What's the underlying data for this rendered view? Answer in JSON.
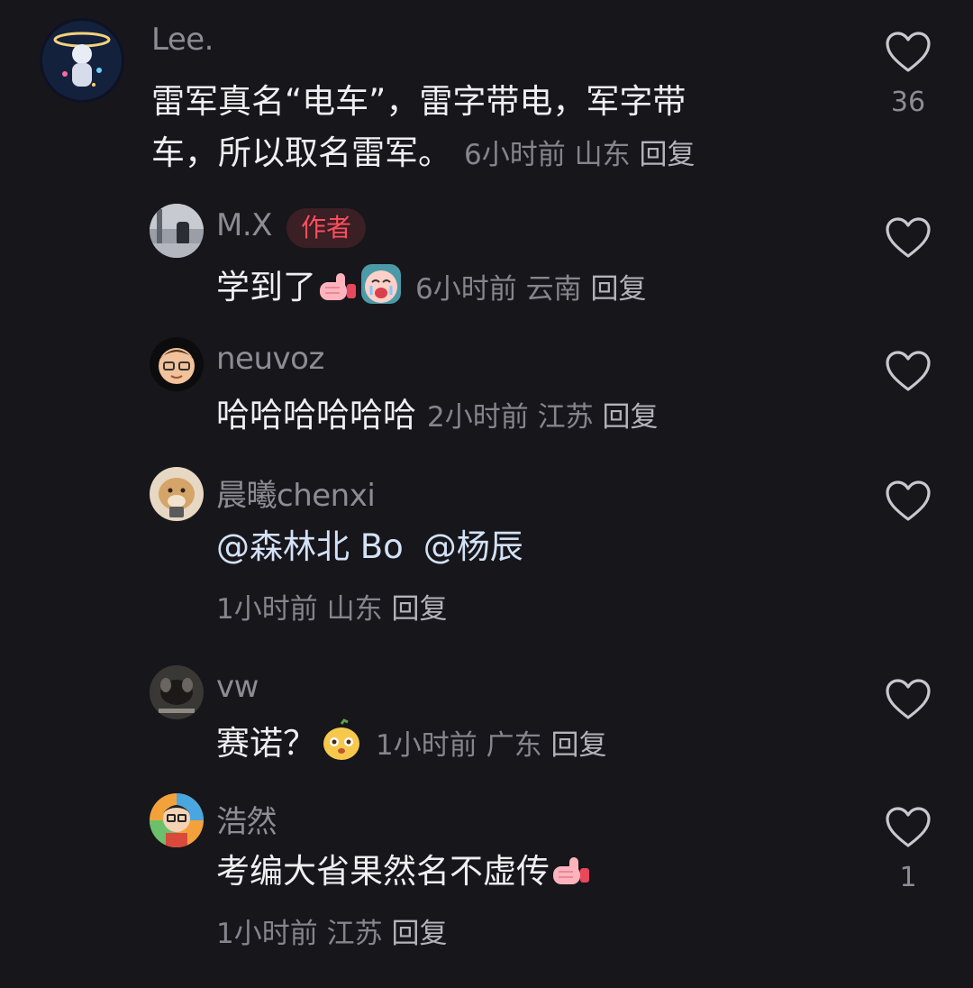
{
  "comments": [
    {
      "user": "Lee.",
      "text_line1": "雷军真名“电车”，雷字带电，军字带",
      "text_line2": "车，所以取名雷军。",
      "time": "6小时前",
      "location": "山东",
      "reply": "回复",
      "likes": "36"
    },
    {
      "user": "M.X",
      "badge": "作者",
      "text": "学到了",
      "time": "6小时前",
      "location": "云南",
      "reply": "回复"
    },
    {
      "user": "neuvoz",
      "text": "哈哈哈哈哈哈",
      "time": "2小时前",
      "location": "江苏",
      "reply": "回复"
    },
    {
      "user": "晨曦chenxi",
      "mention1": "@森林北 Bo",
      "mention2": "@杨辰",
      "time": "1小时前",
      "location": "山东",
      "reply": "回复"
    },
    {
      "user": "vw",
      "text": "赛诺？",
      "time": "1小时前",
      "location": "广东",
      "reply": "回复"
    },
    {
      "user": "浩然",
      "text": "考编大省果然名不虚传",
      "time": "1小时前",
      "location": "江苏",
      "reply": "回复",
      "likes": "1"
    }
  ],
  "icons": {
    "like": "heart-outline-icon",
    "emoji_thumb": "thumbs-up-emoji",
    "emoji_face": "crying-face-emoji",
    "emoji_pear": "pear-mascot-emoji"
  },
  "colors": {
    "background": "#17161b",
    "author_badge_text": "#ff4d5e",
    "author_badge_bg": "#3a1f24"
  }
}
